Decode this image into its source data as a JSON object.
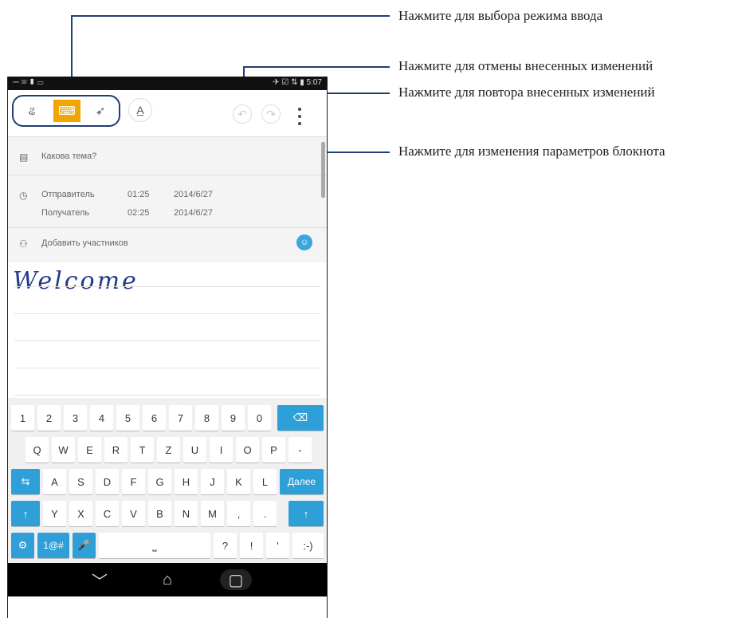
{
  "callouts": {
    "input_mode": "Нажмите для выбора режима ввода",
    "undo": "Нажмите для отмены внесенных изменений",
    "redo": "Нажмите для повтора внесенных изменений",
    "settings": "Нажмите для изменения параметров блокнота"
  },
  "statusbar": {
    "left": "⎓ ✉ ▮ ▭",
    "right": "✈ ☑ ⇅ ▮ 5:07"
  },
  "toolbar": {
    "modes": [
      {
        "icon": "handwriting-icon",
        "glyph": "ଌ"
      },
      {
        "icon": "keyboard-icon",
        "glyph": "⌨"
      },
      {
        "icon": "pen-icon",
        "glyph": "➶"
      }
    ],
    "format_glyph": "A̲",
    "undo_glyph": "↶",
    "redo_glyph": "↷"
  },
  "meta": {
    "subject_placeholder": "Какова тема?",
    "from_label": "Отправитель",
    "from_time": "01:25",
    "from_date": "2014/6/27",
    "to_label": "Получатель",
    "to_time": "02:25",
    "to_date": "2014/6/27",
    "participants_placeholder": "Добавить участников"
  },
  "note": {
    "handwritten": "Welcome"
  },
  "keyboard": {
    "row1": [
      "1",
      "2",
      "3",
      "4",
      "5",
      "6",
      "7",
      "8",
      "9",
      "0"
    ],
    "backspace": "⌫",
    "row2": [
      "Q",
      "W",
      "E",
      "R",
      "T",
      "Z",
      "U",
      "I",
      "O",
      "P",
      "-"
    ],
    "row3": [
      "A",
      "S",
      "D",
      "F",
      "G",
      "H",
      "J",
      "K",
      "L"
    ],
    "tab": "⇆",
    "enter": "Далее",
    "row4": [
      "Y",
      "X",
      "C",
      "V",
      "B",
      "N",
      "M",
      ",",
      "."
    ],
    "shift": "↑",
    "settings": "⚙",
    "symbols": "1@#",
    "mic": "🎤",
    "space": "⎵",
    "row5_extra": [
      "?",
      "!",
      "'",
      ":-)"
    ]
  },
  "navbar": {
    "back": "﹀",
    "home": "⌂",
    "recent": "▢"
  },
  "colors": {
    "accent": "#f0a500",
    "callout_line": "#1f3f72",
    "key_blue": "#2f9fd8",
    "ink": "#243a8c"
  }
}
